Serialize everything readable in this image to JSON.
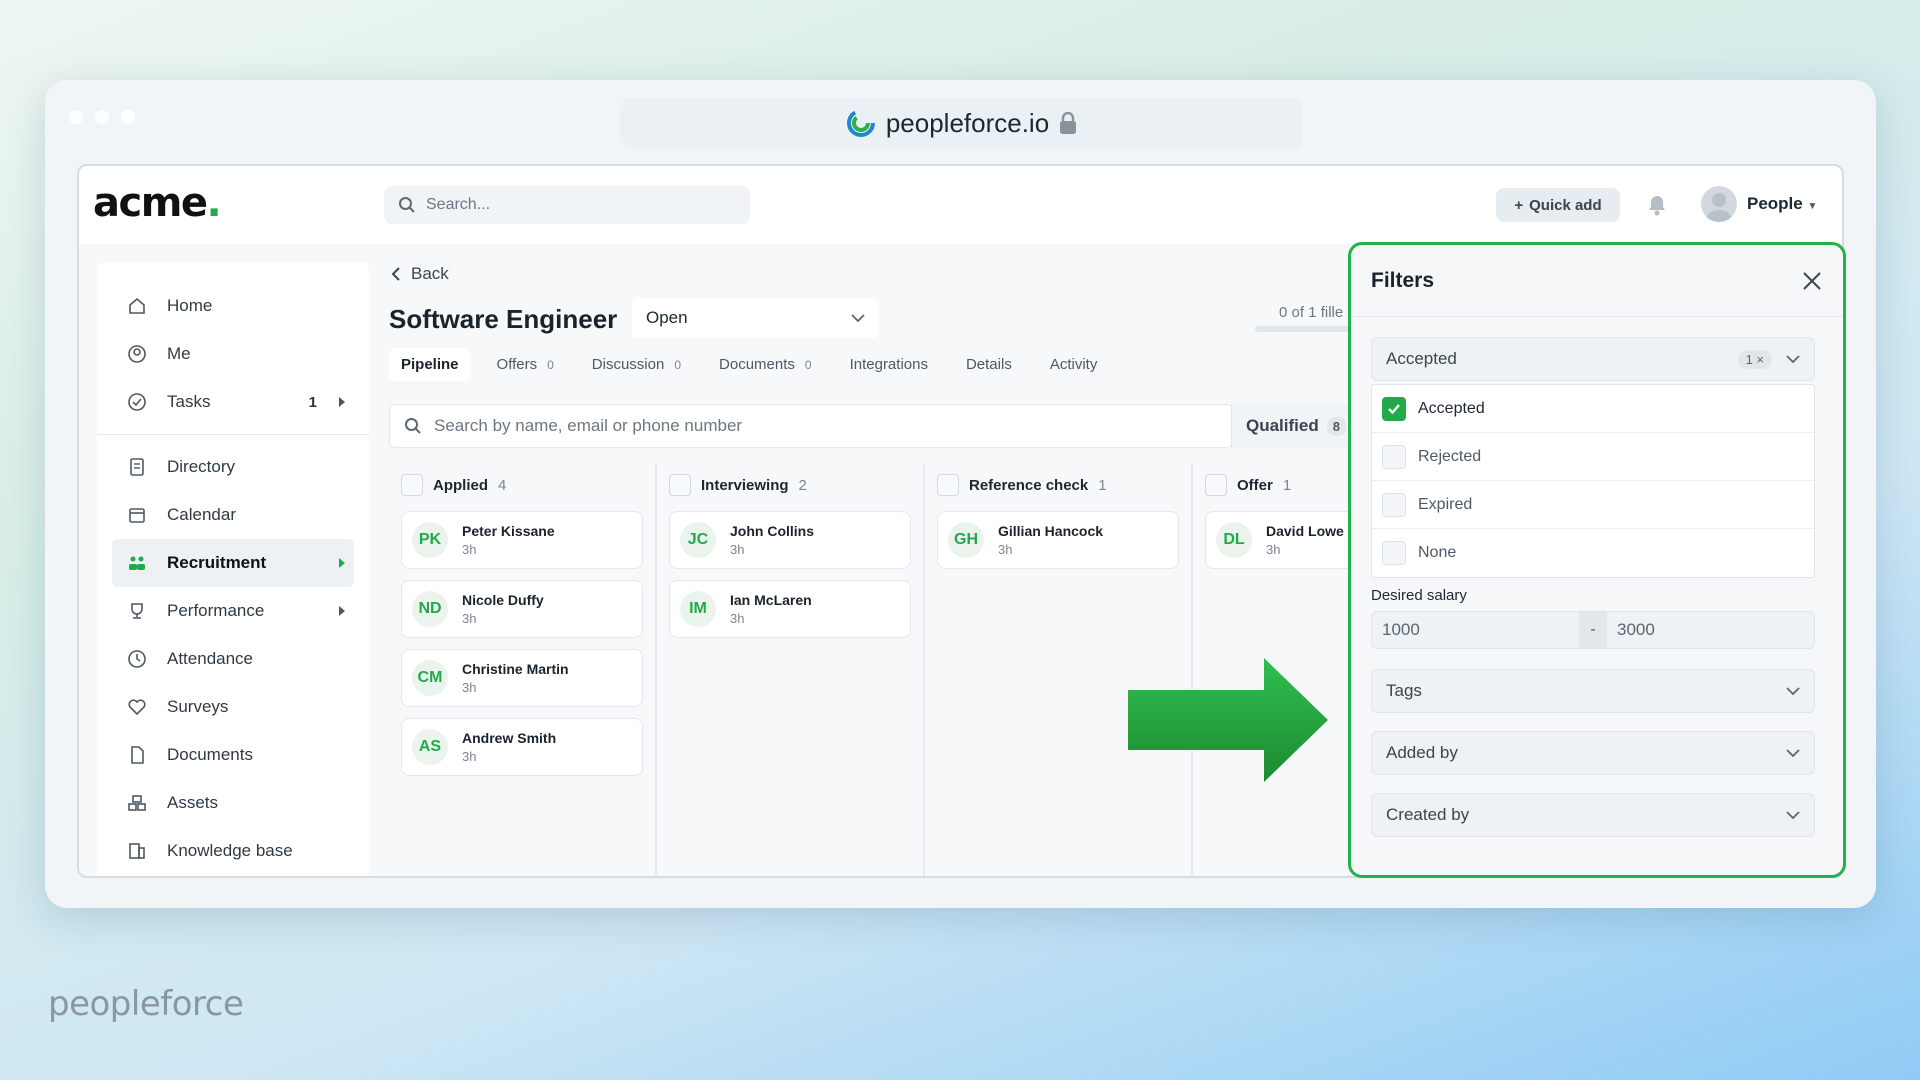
{
  "browser": {
    "url": "peopleforce.io",
    "url_icon": "peopleforce-logo-icon",
    "lock_icon": "lock-icon"
  },
  "topbar": {
    "brand": "acme",
    "brand_dot": ".",
    "search_placeholder": "Search...",
    "quick_add": "Quick add",
    "user_menu": "People"
  },
  "sidebar": {
    "items": [
      {
        "label": "Home",
        "icon": "home-icon"
      },
      {
        "label": "Me",
        "icon": "user-circle-icon"
      },
      {
        "label": "Tasks",
        "icon": "check-circle-icon",
        "badge": "1"
      },
      {
        "label": "Directory",
        "icon": "directory-icon"
      },
      {
        "label": "Calendar",
        "icon": "calendar-icon"
      },
      {
        "label": "Recruitment",
        "icon": "recruitment-icon"
      },
      {
        "label": "Performance",
        "icon": "trophy-icon"
      },
      {
        "label": "Attendance",
        "icon": "clock-icon"
      },
      {
        "label": "Surveys",
        "icon": "heart-icon"
      },
      {
        "label": "Documents",
        "icon": "document-icon"
      },
      {
        "label": "Assets",
        "icon": "assets-icon"
      },
      {
        "label": "Knowledge base",
        "icon": "knowledge-base-icon"
      }
    ]
  },
  "main": {
    "back": "Back",
    "title": "Software Engineer",
    "status": "Open",
    "filled_text": "0 of 1 fille",
    "tabs": [
      {
        "label": "Pipeline",
        "count": ""
      },
      {
        "label": "Offers",
        "count": "0"
      },
      {
        "label": "Discussion",
        "count": "0"
      },
      {
        "label": "Documents",
        "count": "0"
      },
      {
        "label": "Integrations",
        "count": ""
      },
      {
        "label": "Details",
        "count": ""
      },
      {
        "label": "Activity",
        "count": ""
      }
    ],
    "search_placeholder": "Search by name, email or phone number",
    "qualified": {
      "label": "Qualified",
      "count": "8"
    }
  },
  "board": {
    "columns": [
      {
        "title": "Applied",
        "count": "4",
        "cards": [
          {
            "initials": "PK",
            "name": "Peter Kissane",
            "time": "3h"
          },
          {
            "initials": "ND",
            "name": "Nicole Duffy",
            "time": "3h"
          },
          {
            "initials": "CM",
            "name": "Christine Martin",
            "time": "3h"
          },
          {
            "initials": "AS",
            "name": "Andrew Smith",
            "time": "3h"
          }
        ]
      },
      {
        "title": "Interviewing",
        "count": "2",
        "cards": [
          {
            "initials": "JC",
            "name": "John Collins",
            "time": "3h"
          },
          {
            "initials": "IM",
            "name": "Ian McLaren",
            "time": "3h"
          }
        ]
      },
      {
        "title": "Reference check",
        "count": "1",
        "cards": [
          {
            "initials": "GH",
            "name": "Gillian Hancock",
            "time": "3h"
          }
        ]
      },
      {
        "title": "Offer",
        "count": "1",
        "cards": [
          {
            "initials": "DL",
            "name": "David Lowe",
            "time": "3h"
          }
        ]
      }
    ]
  },
  "filters": {
    "title": "Filters",
    "offer_status": {
      "value": "Accepted",
      "chip": "1 ×"
    },
    "options": [
      {
        "label": "Accepted",
        "checked": true
      },
      {
        "label": "Rejected",
        "checked": false
      },
      {
        "label": "Expired",
        "checked": false
      },
      {
        "label": "None",
        "checked": false
      }
    ],
    "salary_label": "Desired salary",
    "salary_min": "1000",
    "salary_sep": "-",
    "salary_max": "3000",
    "tags": "Tags",
    "added_by": "Added by",
    "created_by": "Created by"
  },
  "colors": {
    "accent": "#22a94a",
    "highlight_border": "#22b14c",
    "arrow": "#22a03e"
  },
  "footer": {
    "brand": "peopleforce"
  }
}
